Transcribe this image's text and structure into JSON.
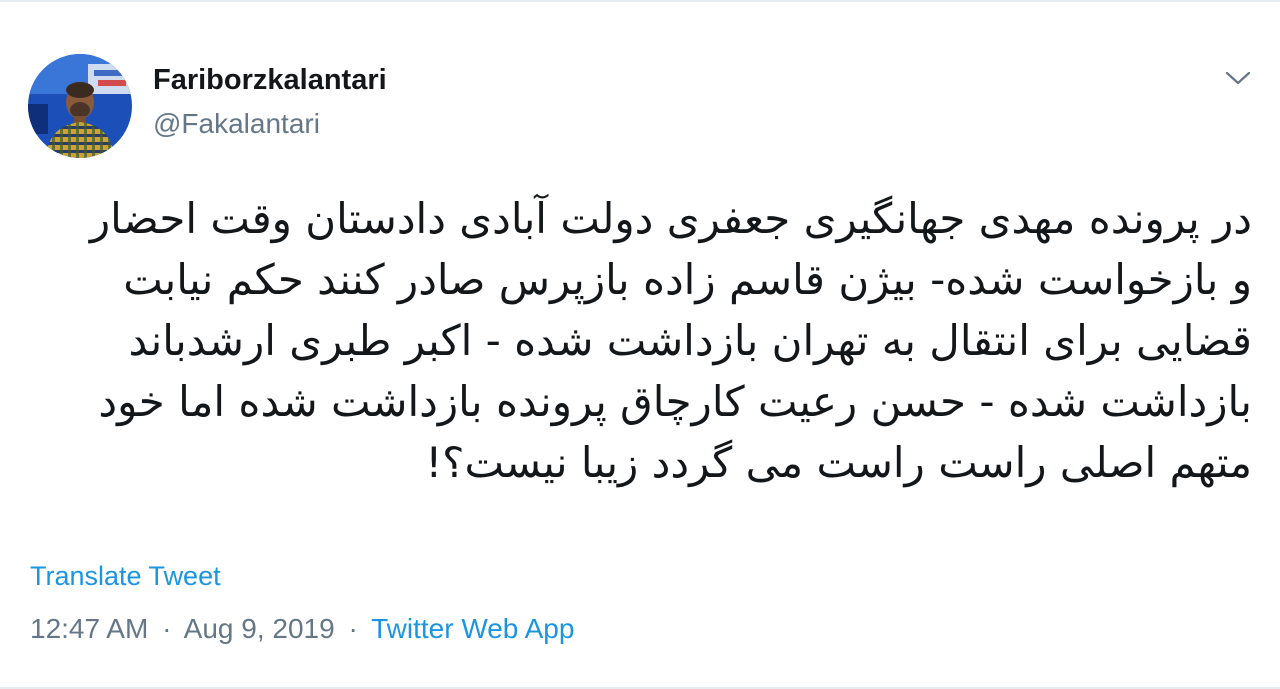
{
  "user": {
    "display_name": "Fariborzkalantari",
    "handle": "@Fakalantari",
    "avatar_icon": "profile-photo"
  },
  "menu": {
    "icon": "chevron-down-icon"
  },
  "tweet": {
    "lines": [
      "در پرونده مهدی جهانگیری جعفری دولت آبادی دادستان وقت احضار",
      "و بازخواست شده- بیژن قاسم زاده بازپرس صادر کنند حکم نیابت",
      "قضایی برای انتقال به تهران بازداشت شده - اکبر طبری ارشدباند",
      "بازداشت شده - حسن رعیت کارچاق پرونده بازداشت شده اما خود",
      "متهم اصلی راست راست می گردد زیبا نیست؟!"
    ]
  },
  "actions": {
    "translate_label": "Translate Tweet"
  },
  "meta": {
    "time": "12:47 AM",
    "separator_1": "·",
    "date": "Aug 9, 2019",
    "separator_2": "·",
    "source": "Twitter Web App"
  },
  "colors": {
    "link": "#1b95e0",
    "secondary_text": "#657786",
    "primary_text": "#14171a",
    "border": "#e6ecf0"
  }
}
